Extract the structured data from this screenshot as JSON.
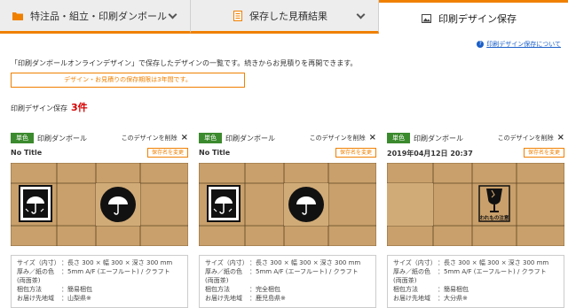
{
  "tabs": [
    {
      "label": "特注品・組立・印刷ダンボール",
      "icon": "folder-icon",
      "active": false
    },
    {
      "label": "保存した見積結果",
      "icon": "document-icon",
      "active": false
    },
    {
      "label": "印刷デザイン保存",
      "icon": "image-icon",
      "active": true
    }
  ],
  "help_link": "印刷デザイン保存について",
  "description": "「印刷ダンボールオンラインデザイン」で保存したデザインの一覧です。続きからお見積りを再開できます。",
  "notice": "デザイン・お見積りの保存期限は3年間です。",
  "saved_count": {
    "label": "印刷デザイン保存",
    "value": "3件"
  },
  "cards": [
    {
      "badge": "単色",
      "category": "印刷ダンボール",
      "delete_label": "このデザインを削除",
      "title": "No Title",
      "rename_label": "保存名を変更",
      "print_marks": [
        "umbrella-mark",
        "umbrella-circle-mark"
      ],
      "specs": {
        "size_label": "サイズ（内寸）",
        "size": "：長さ 300 × 幅 300 × 深さ 300 mm",
        "material_label": "厚み／紙の色",
        "material": "：5mm A/F (エーフルート) / クラフト",
        "material_note": "(両面茶)",
        "packing_label": "梱包方法",
        "packing": "：簡易梱包",
        "dest_label": "お届け先地域",
        "dest": "：山梨県※"
      }
    },
    {
      "badge": "単色",
      "category": "印刷ダンボール",
      "delete_label": "このデザインを削除",
      "title": "No Title",
      "rename_label": "保存名を変更",
      "print_marks": [
        "umbrella-mark",
        "umbrella-circle-mark"
      ],
      "specs": {
        "size_label": "サイズ（内寸）",
        "size": "：長さ 300 × 幅 300 × 深さ 300 mm",
        "material_label": "厚み／紙の色",
        "material": "：5mm A/F (エーフルート) / クラフト",
        "material_note": "(両面茶)",
        "packing_label": "梱包方法",
        "packing": "：完全梱包",
        "dest_label": "お届け先地域",
        "dest": "：鹿児島県※"
      }
    },
    {
      "badge": "単色",
      "category": "印刷ダンボール",
      "delete_label": "このデザインを削除",
      "title": "2019年04月12日 20:37",
      "rename_label": "保存名を変更",
      "print_marks": [
        "fragile-mark"
      ],
      "fragile_caption": "われもの注意",
      "specs": {
        "size_label": "サイズ（内寸）",
        "size": "：長さ 300 × 幅 300 × 深さ 300 mm",
        "material_label": "厚み／紙の色",
        "material": "：5mm A/F (エーフルート) / クラフト",
        "material_note": "(両面茶)",
        "packing_label": "梱包方法",
        "packing": "：簡易梱包",
        "dest_label": "お届け先地域",
        "dest": "：大分県※"
      }
    }
  ],
  "colors": {
    "accent": "#f08000",
    "badge": "#3c8a2e",
    "count": "#d40000",
    "kraft": "#c9a06b",
    "kraft_line": "#8a6a3d",
    "link": "#1a5fc8"
  }
}
